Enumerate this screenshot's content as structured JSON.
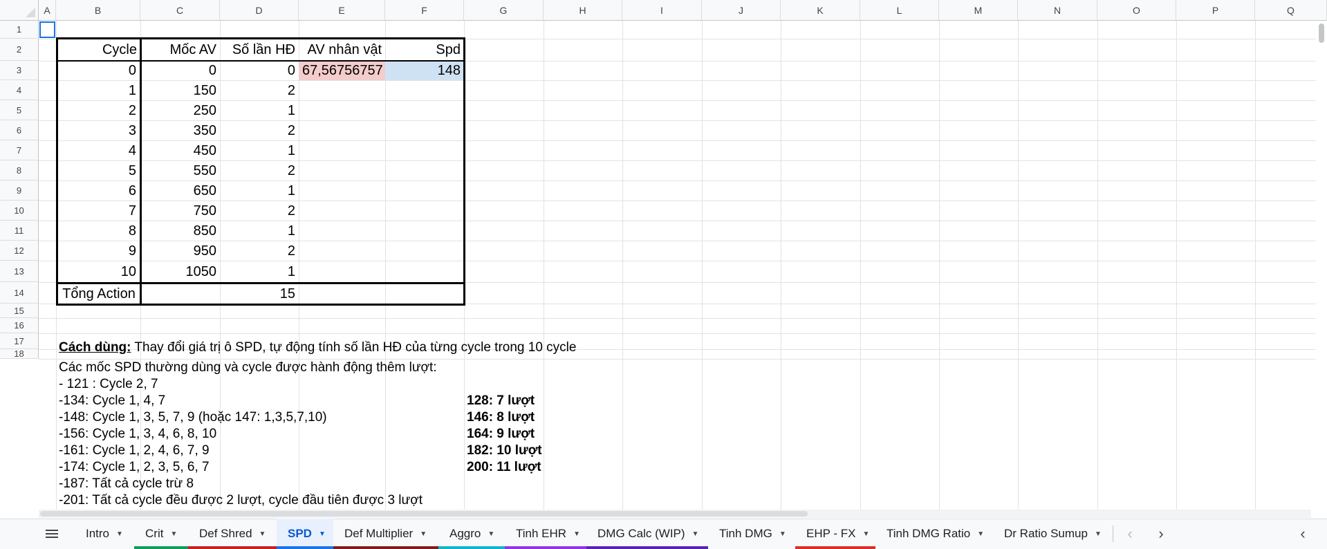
{
  "columns": [
    "A",
    "B",
    "C",
    "D",
    "E",
    "F",
    "G",
    "H",
    "I",
    "J",
    "K",
    "L",
    "M",
    "N",
    "O",
    "P",
    "Q"
  ],
  "rows": [
    "1",
    "2",
    "3",
    "4",
    "5",
    "6",
    "7",
    "8",
    "9",
    "10",
    "11",
    "12",
    "13",
    "14",
    "15",
    "16",
    "17",
    "18"
  ],
  "table": {
    "headers": {
      "cycle": "Cycle",
      "moc_av": "Mốc AV",
      "so_lan_hd": "Số lần HĐ",
      "av_nhan_vat": "AV nhân vật",
      "spd": "Spd"
    },
    "av_value": "67,56756757",
    "spd_value": "148",
    "av_color": "#f4cccc",
    "spd_color": "#cfe2f3",
    "rows": [
      {
        "cycle": "0",
        "moc": "0",
        "hd": "0"
      },
      {
        "cycle": "1",
        "moc": "150",
        "hd": "2"
      },
      {
        "cycle": "2",
        "moc": "250",
        "hd": "1"
      },
      {
        "cycle": "3",
        "moc": "350",
        "hd": "2"
      },
      {
        "cycle": "4",
        "moc": "450",
        "hd": "1"
      },
      {
        "cycle": "5",
        "moc": "550",
        "hd": "2"
      },
      {
        "cycle": "6",
        "moc": "650",
        "hd": "1"
      },
      {
        "cycle": "7",
        "moc": "750",
        "hd": "2"
      },
      {
        "cycle": "8",
        "moc": "850",
        "hd": "1"
      },
      {
        "cycle": "9",
        "moc": "950",
        "hd": "2"
      },
      {
        "cycle": "10",
        "moc": "1050",
        "hd": "1"
      }
    ],
    "total_label": "Tổng Action",
    "total_value": "15"
  },
  "usage": {
    "label": "Cách dùng:",
    "text": " Thay đổi giá trị ô SPD, tự động tính số lần HĐ của từng cycle trong 10 cycle"
  },
  "notes": {
    "title": "Các mốc SPD thường dùng và cycle được hành động thêm lượt:",
    "lines": [
      "- 121 : Cycle 2, 7",
      "-134: Cycle 1, 4, 7",
      "-148: Cycle 1, 3, 5, 7, 9 (hoặc 147: 1,3,5,7,10)",
      "-156: Cycle 1, 3, 4, 6, 8, 10",
      "-161: Cycle 1, 2, 4, 6, 7, 9",
      "-174: Cycle 1, 2, 3, 5, 6, 7",
      "-187: Tất cả cycle trừ 8",
      "-201: Tất cả cycle đều được 2 lượt, cycle đầu tiên được 3 lượt"
    ],
    "turns": [
      "128: 7 lượt",
      "146: 8 lượt",
      "164: 9 lượt",
      "182: 10 lượt",
      "200: 11 lượt"
    ]
  },
  "tabs": [
    {
      "label": "Intro",
      "color": ""
    },
    {
      "label": "Crit",
      "color": "#0f9d58"
    },
    {
      "label": "Def Shred",
      "color": "#c5221f"
    },
    {
      "label": "SPD",
      "color": "#1a73e8"
    },
    {
      "label": "Def Multiplier",
      "color": "#7f1d1d"
    },
    {
      "label": "Aggro",
      "color": "#12b5cb"
    },
    {
      "label": "Tinh EHR",
      "color": "#9334e6"
    },
    {
      "label": "DMG Calc (WIP)",
      "color": "#5b21b6"
    },
    {
      "label": "Tinh DMG",
      "color": ""
    },
    {
      "label": "EHP - FX",
      "color": "#d93025"
    },
    {
      "label": "Tinh DMG Ratio",
      "color": ""
    },
    {
      "label": "Dr Ratio Sumup",
      "color": ""
    }
  ],
  "active_tab": "SPD",
  "icons": {
    "menu": "menu-icon",
    "prev": "chevron-left-icon",
    "next": "chevron-right-icon",
    "collapse": "collapse-icon"
  }
}
